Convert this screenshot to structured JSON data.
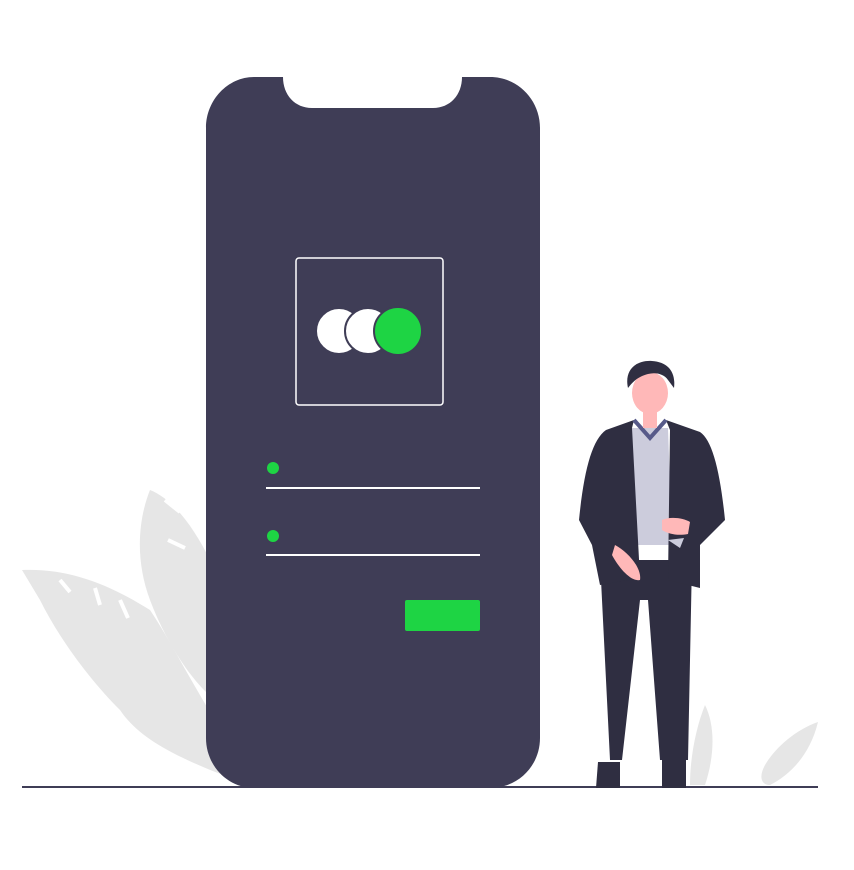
{
  "illustration": {
    "subject": "mobile-login-screen",
    "colors": {
      "background": "#ffffff",
      "phone_body": "#3f3d56",
      "accent": "#1ed444",
      "foliage": "#e6e6e6",
      "field_line": "#ffffff",
      "suit": "#2f2e41",
      "shirt": "#ccccdc",
      "skin": "#ffb8b8",
      "hair": "#2f2e41",
      "ground_line": "#3f3d56"
    },
    "login_form": {
      "logo_icon": "overlapping-circles-icon",
      "fields": [
        {
          "name": "username-field",
          "indicator": "green-dot"
        },
        {
          "name": "password-field",
          "indicator": "green-dot"
        }
      ],
      "submit_button": {
        "label": ""
      }
    }
  }
}
